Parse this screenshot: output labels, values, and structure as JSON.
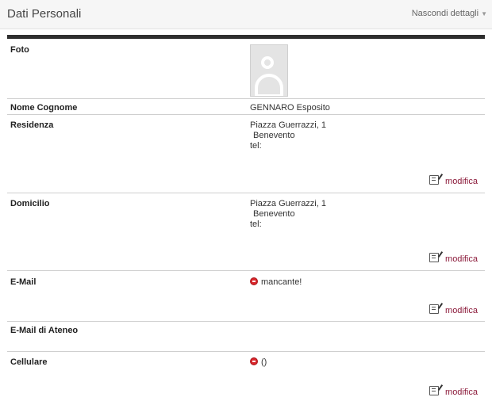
{
  "header": {
    "title": "Dati Personali",
    "toggle_label": "Nascondi dettagli",
    "toggle_icon": "caret-down-icon"
  },
  "rows": [
    {
      "label": "Foto",
      "photo_icon": "user-placeholder-icon"
    },
    {
      "label": "Nome Cognome",
      "value": "GENNARO Esposito"
    },
    {
      "label": "Residenza",
      "address": "Piazza Guerrazzi, 1",
      "city": "Benevento",
      "tel": "tel:",
      "edit": "modifica"
    },
    {
      "label": "Domicilio",
      "address": "Piazza Guerrazzi, 1",
      "city": "Benevento",
      "tel": "tel:",
      "edit": "modifica"
    },
    {
      "label": "E-Mail",
      "value": "mancante!",
      "edit": "modifica",
      "status_icon": "error-icon"
    },
    {
      "label": "E-Mail di Ateneo"
    },
    {
      "label": "Cellulare",
      "value": "()",
      "edit": "modifica",
      "status_icon": "error-icon"
    }
  ],
  "colors": {
    "link": "#8b1a3a",
    "error": "#d9262c",
    "separator": "#2f2f2f"
  }
}
